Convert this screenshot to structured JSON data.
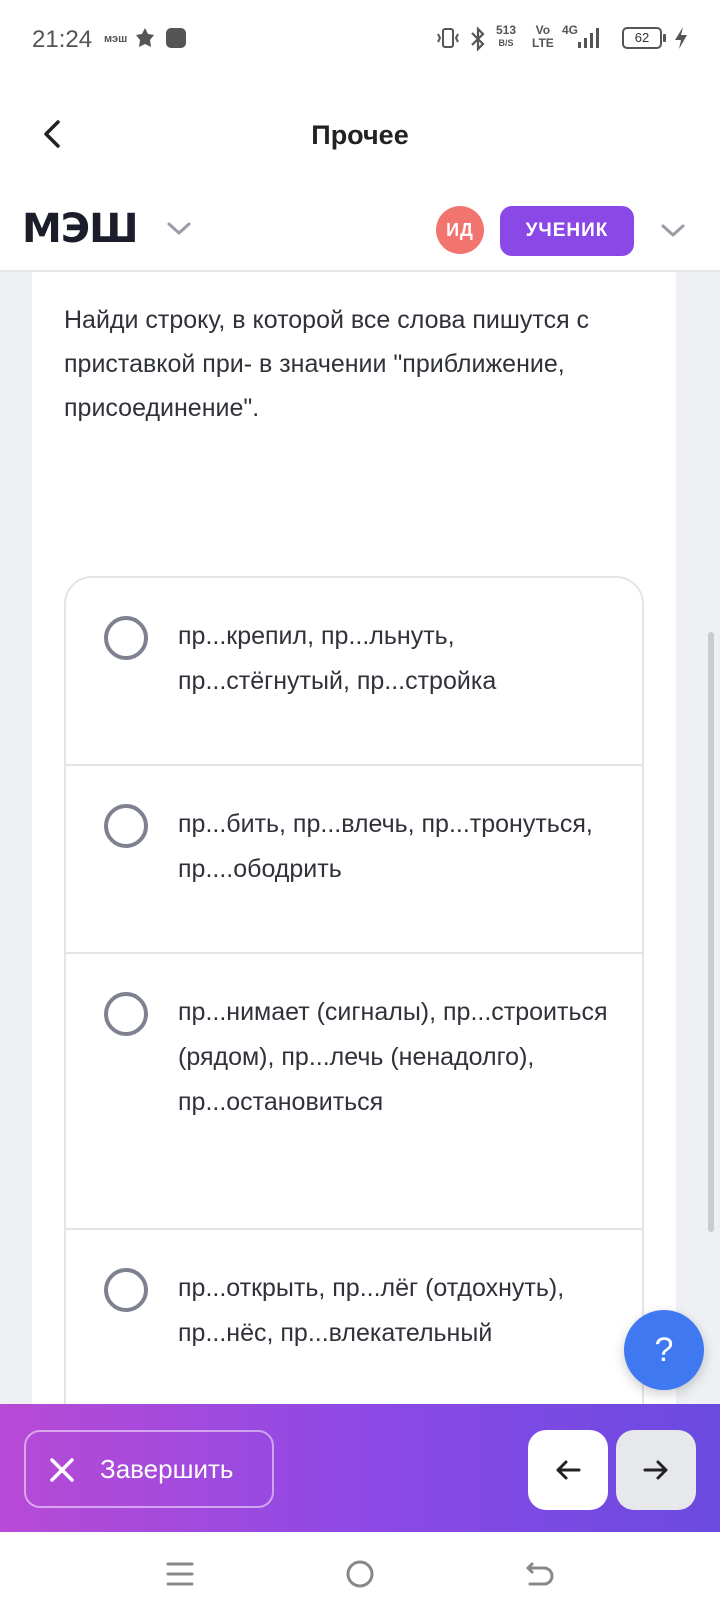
{
  "status_bar": {
    "time": "21:24",
    "app_label": "мэш",
    "net_speed": "513",
    "net_unit": "B/S",
    "volte_top": "Vo",
    "volte_bottom": "LTE",
    "network": "4G",
    "battery": "62"
  },
  "header": {
    "title": "Прочее"
  },
  "mesh_bar": {
    "logo": "МЭШ",
    "avatar_initials": "ИД",
    "role": "УЧЕНИК"
  },
  "question": {
    "text": "Найди строку, в которой все слова пишутся с приставкой при- в значении \"приближение, присоединение\"."
  },
  "options": [
    {
      "text": "пр...крепил, пр...льнуть, пр...стёгнутый, пр...стройка",
      "selected": false
    },
    {
      "text": "пр...бить, пр...влечь, пр...тронуться, пр....ободрить",
      "selected": false
    },
    {
      "text": "пр...нимает (сигналы), пр...строиться (рядом), пр...лечь (ненадолго), пр...остановиться",
      "selected": false
    },
    {
      "text": "пр...открыть, пр...лёг (отдохнуть), пр...нёс, пр...влекательный",
      "selected": false
    }
  ],
  "help": {
    "label": "?"
  },
  "action_bar": {
    "finish_label": "Завершить"
  },
  "colors": {
    "accent_purple": "#8a49e6",
    "gradient_start": "#b84ad6",
    "avatar_bg": "#f2746e",
    "help_blue": "#3f78f0"
  }
}
